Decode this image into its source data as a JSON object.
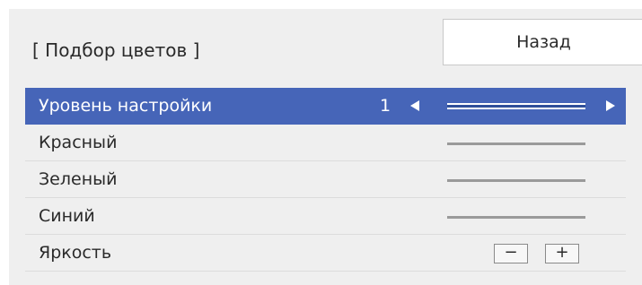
{
  "header": {
    "title": "[ Подбор цветов ]",
    "back_label": "Назад"
  },
  "rows": [
    {
      "label": "Уровень настройки",
      "value": "1",
      "selected": true
    },
    {
      "label": "Красный"
    },
    {
      "label": "Зеленый"
    },
    {
      "label": "Синий"
    },
    {
      "label": "Яркость",
      "minus": "−",
      "plus": "+"
    }
  ],
  "colors": {
    "selected_bg": "#4665b8",
    "panel_bg": "#efefef"
  },
  "icons": [
    "left-arrow-icon",
    "right-arrow-icon"
  ]
}
